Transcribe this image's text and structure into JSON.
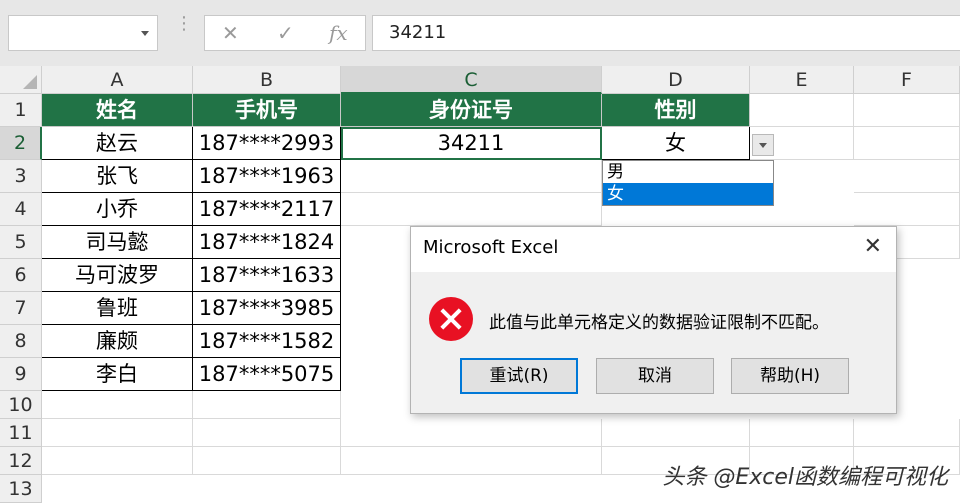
{
  "formula_bar": {
    "value": "34211",
    "cancel_icon": "✕",
    "enter_icon": "✓",
    "fx_label": "fx"
  },
  "columns": [
    "A",
    "B",
    "C",
    "D",
    "E",
    "F"
  ],
  "rows": [
    "1",
    "2",
    "3",
    "4",
    "5",
    "6",
    "7",
    "8",
    "9",
    "10",
    "11",
    "12",
    "13"
  ],
  "headers": {
    "name": "姓名",
    "phone": "手机号",
    "id": "身份证号",
    "gender": "性别"
  },
  "data": [
    {
      "name": "赵云",
      "phone": "187****2993",
      "id": "34211",
      "gender": "女"
    },
    {
      "name": "张飞",
      "phone": "187****1963"
    },
    {
      "name": "小乔",
      "phone": "187****2117"
    },
    {
      "name": "司马懿",
      "phone": "187****1824"
    },
    {
      "name": "马可波罗",
      "phone": "187****1633"
    },
    {
      "name": "鲁班",
      "phone": "187****3985"
    },
    {
      "name": "廉颇",
      "phone": "187****1582"
    },
    {
      "name": "李白",
      "phone": "187****5075"
    }
  ],
  "dropdown": {
    "options": [
      "男",
      "女"
    ],
    "selected": "女"
  },
  "dialog": {
    "title": "Microsoft Excel",
    "message": "此值与此单元格定义的数据验证限制不匹配。",
    "buttons": {
      "retry": "重试(R)",
      "cancel": "取消",
      "help": "帮助(H)"
    }
  },
  "watermark": "头条 @Excel函数编程可视化",
  "colors": {
    "header_green": "#217346",
    "error_red": "#e81123",
    "selection_blue": "#0078d7"
  }
}
